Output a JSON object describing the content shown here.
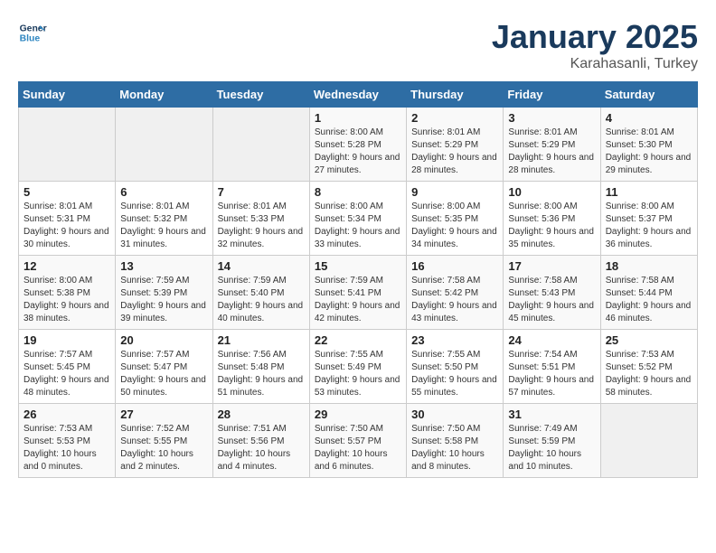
{
  "logo": {
    "line1": "General",
    "line2": "Blue"
  },
  "title": "January 2025",
  "subtitle": "Karahasanli, Turkey",
  "weekdays": [
    "Sunday",
    "Monday",
    "Tuesday",
    "Wednesday",
    "Thursday",
    "Friday",
    "Saturday"
  ],
  "weeks": [
    [
      {
        "day": "",
        "info": ""
      },
      {
        "day": "",
        "info": ""
      },
      {
        "day": "",
        "info": ""
      },
      {
        "day": "1",
        "info": "Sunrise: 8:00 AM\nSunset: 5:28 PM\nDaylight: 9 hours and 27 minutes."
      },
      {
        "day": "2",
        "info": "Sunrise: 8:01 AM\nSunset: 5:29 PM\nDaylight: 9 hours and 28 minutes."
      },
      {
        "day": "3",
        "info": "Sunrise: 8:01 AM\nSunset: 5:29 PM\nDaylight: 9 hours and 28 minutes."
      },
      {
        "day": "4",
        "info": "Sunrise: 8:01 AM\nSunset: 5:30 PM\nDaylight: 9 hours and 29 minutes."
      }
    ],
    [
      {
        "day": "5",
        "info": "Sunrise: 8:01 AM\nSunset: 5:31 PM\nDaylight: 9 hours and 30 minutes."
      },
      {
        "day": "6",
        "info": "Sunrise: 8:01 AM\nSunset: 5:32 PM\nDaylight: 9 hours and 31 minutes."
      },
      {
        "day": "7",
        "info": "Sunrise: 8:01 AM\nSunset: 5:33 PM\nDaylight: 9 hours and 32 minutes."
      },
      {
        "day": "8",
        "info": "Sunrise: 8:00 AM\nSunset: 5:34 PM\nDaylight: 9 hours and 33 minutes."
      },
      {
        "day": "9",
        "info": "Sunrise: 8:00 AM\nSunset: 5:35 PM\nDaylight: 9 hours and 34 minutes."
      },
      {
        "day": "10",
        "info": "Sunrise: 8:00 AM\nSunset: 5:36 PM\nDaylight: 9 hours and 35 minutes."
      },
      {
        "day": "11",
        "info": "Sunrise: 8:00 AM\nSunset: 5:37 PM\nDaylight: 9 hours and 36 minutes."
      }
    ],
    [
      {
        "day": "12",
        "info": "Sunrise: 8:00 AM\nSunset: 5:38 PM\nDaylight: 9 hours and 38 minutes."
      },
      {
        "day": "13",
        "info": "Sunrise: 7:59 AM\nSunset: 5:39 PM\nDaylight: 9 hours and 39 minutes."
      },
      {
        "day": "14",
        "info": "Sunrise: 7:59 AM\nSunset: 5:40 PM\nDaylight: 9 hours and 40 minutes."
      },
      {
        "day": "15",
        "info": "Sunrise: 7:59 AM\nSunset: 5:41 PM\nDaylight: 9 hours and 42 minutes."
      },
      {
        "day": "16",
        "info": "Sunrise: 7:58 AM\nSunset: 5:42 PM\nDaylight: 9 hours and 43 minutes."
      },
      {
        "day": "17",
        "info": "Sunrise: 7:58 AM\nSunset: 5:43 PM\nDaylight: 9 hours and 45 minutes."
      },
      {
        "day": "18",
        "info": "Sunrise: 7:58 AM\nSunset: 5:44 PM\nDaylight: 9 hours and 46 minutes."
      }
    ],
    [
      {
        "day": "19",
        "info": "Sunrise: 7:57 AM\nSunset: 5:45 PM\nDaylight: 9 hours and 48 minutes."
      },
      {
        "day": "20",
        "info": "Sunrise: 7:57 AM\nSunset: 5:47 PM\nDaylight: 9 hours and 50 minutes."
      },
      {
        "day": "21",
        "info": "Sunrise: 7:56 AM\nSunset: 5:48 PM\nDaylight: 9 hours and 51 minutes."
      },
      {
        "day": "22",
        "info": "Sunrise: 7:55 AM\nSunset: 5:49 PM\nDaylight: 9 hours and 53 minutes."
      },
      {
        "day": "23",
        "info": "Sunrise: 7:55 AM\nSunset: 5:50 PM\nDaylight: 9 hours and 55 minutes."
      },
      {
        "day": "24",
        "info": "Sunrise: 7:54 AM\nSunset: 5:51 PM\nDaylight: 9 hours and 57 minutes."
      },
      {
        "day": "25",
        "info": "Sunrise: 7:53 AM\nSunset: 5:52 PM\nDaylight: 9 hours and 58 minutes."
      }
    ],
    [
      {
        "day": "26",
        "info": "Sunrise: 7:53 AM\nSunset: 5:53 PM\nDaylight: 10 hours and 0 minutes."
      },
      {
        "day": "27",
        "info": "Sunrise: 7:52 AM\nSunset: 5:55 PM\nDaylight: 10 hours and 2 minutes."
      },
      {
        "day": "28",
        "info": "Sunrise: 7:51 AM\nSunset: 5:56 PM\nDaylight: 10 hours and 4 minutes."
      },
      {
        "day": "29",
        "info": "Sunrise: 7:50 AM\nSunset: 5:57 PM\nDaylight: 10 hours and 6 minutes."
      },
      {
        "day": "30",
        "info": "Sunrise: 7:50 AM\nSunset: 5:58 PM\nDaylight: 10 hours and 8 minutes."
      },
      {
        "day": "31",
        "info": "Sunrise: 7:49 AM\nSunset: 5:59 PM\nDaylight: 10 hours and 10 minutes."
      },
      {
        "day": "",
        "info": ""
      }
    ]
  ]
}
